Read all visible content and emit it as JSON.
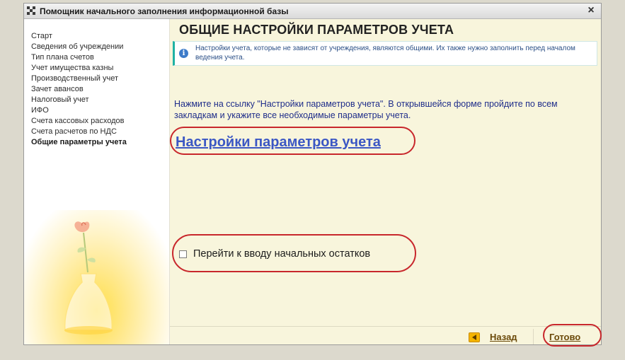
{
  "window": {
    "title": "Помощник начального заполнения информационной базы",
    "close_icon": "close-icon"
  },
  "sidebar": {
    "steps": [
      {
        "label": "Старт",
        "active": false
      },
      {
        "label": "Сведения об учреждении",
        "active": false
      },
      {
        "label": "Тип плана счетов",
        "active": false
      },
      {
        "label": "Учет имущества казны",
        "active": false
      },
      {
        "label": "Производственный учет",
        "active": false
      },
      {
        "label": "Зачет авансов",
        "active": false
      },
      {
        "label": "Налоговый учет",
        "active": false
      },
      {
        "label": "ИФО",
        "active": false
      },
      {
        "label": "Счета кассовых расходов",
        "active": false
      },
      {
        "label": "Счета расчетов по НДС",
        "active": false
      },
      {
        "label": "Общие параметры учета",
        "active": true
      }
    ]
  },
  "main": {
    "heading": "ОБЩИЕ НАСТРОЙКИ ПАРАМЕТРОВ УЧЕТА",
    "info_text": "Настройки учета, которые не зависят от учреждения, являются общими. Их также нужно заполнить перед началом ведения учета.",
    "instruction": "Нажмите на ссылку \"Настройки параметров учета\".  В открывшейся форме пройдите по всем закладкам и укажите все необходимые параметры учета.",
    "settings_link": "Настройки параметров учета",
    "checkbox_label": "Перейти к вводу начальных остатков",
    "checkbox_checked": false
  },
  "footer": {
    "back_label": "Назад",
    "done_label": "Готово"
  },
  "colors": {
    "main_background": "#f8f5dc",
    "link": "#3b57c4",
    "highlight_oval": "#c8272c",
    "info_accent": "#20b2a4"
  }
}
